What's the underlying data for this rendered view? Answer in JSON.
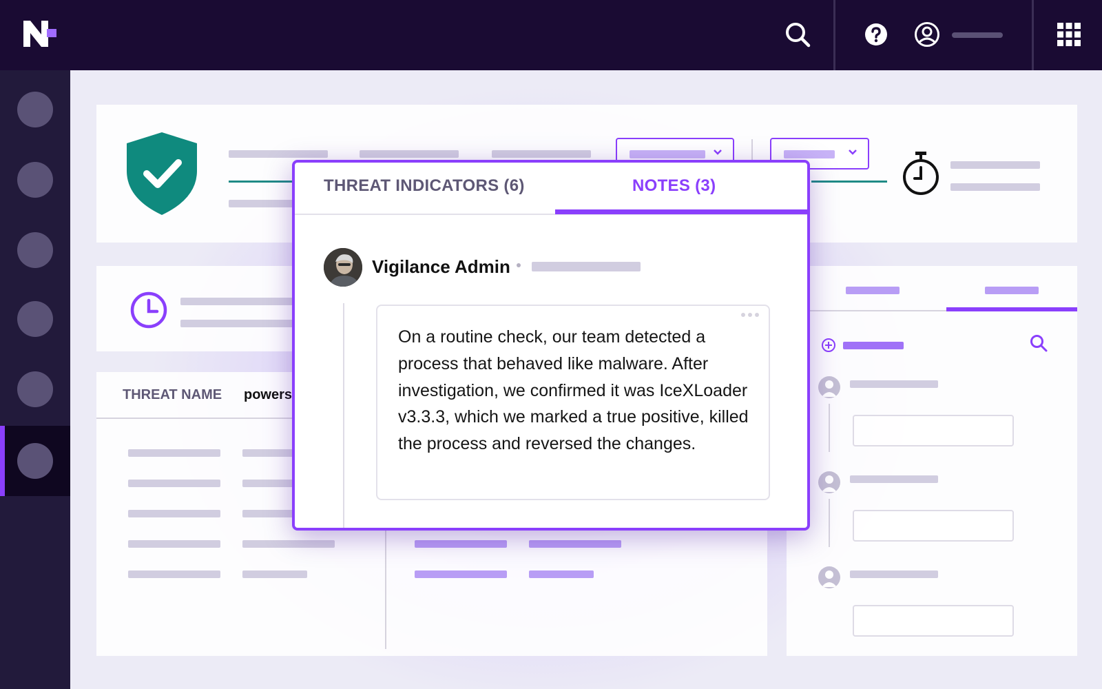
{
  "topbar": {
    "logo_icon": "n-logo-icon",
    "search_icon": "search-icon",
    "help_icon": "help-icon",
    "user_icon": "user-icon",
    "apps_icon": "grid-icon"
  },
  "popup": {
    "tabs": [
      {
        "label": "THREAT INDICATORS (6)",
        "active": false
      },
      {
        "label": "NOTES (3)",
        "active": true
      }
    ],
    "note": {
      "author": "Vigilance Admin",
      "text": "On a routine check, our team detected a process that behaved like malware.  After investigation, we confirmed it was IceXLoader v3.3.3, which we marked a true positive, killed the process and reversed the changes."
    }
  },
  "table": {
    "col_threat_name": "THREAT NAME",
    "col_value": "powers"
  },
  "colors": {
    "accent": "#8a3ffc",
    "topbar": "#1a0b33",
    "sidebar": "#221a3b",
    "shield": "#0f8a7e"
  }
}
